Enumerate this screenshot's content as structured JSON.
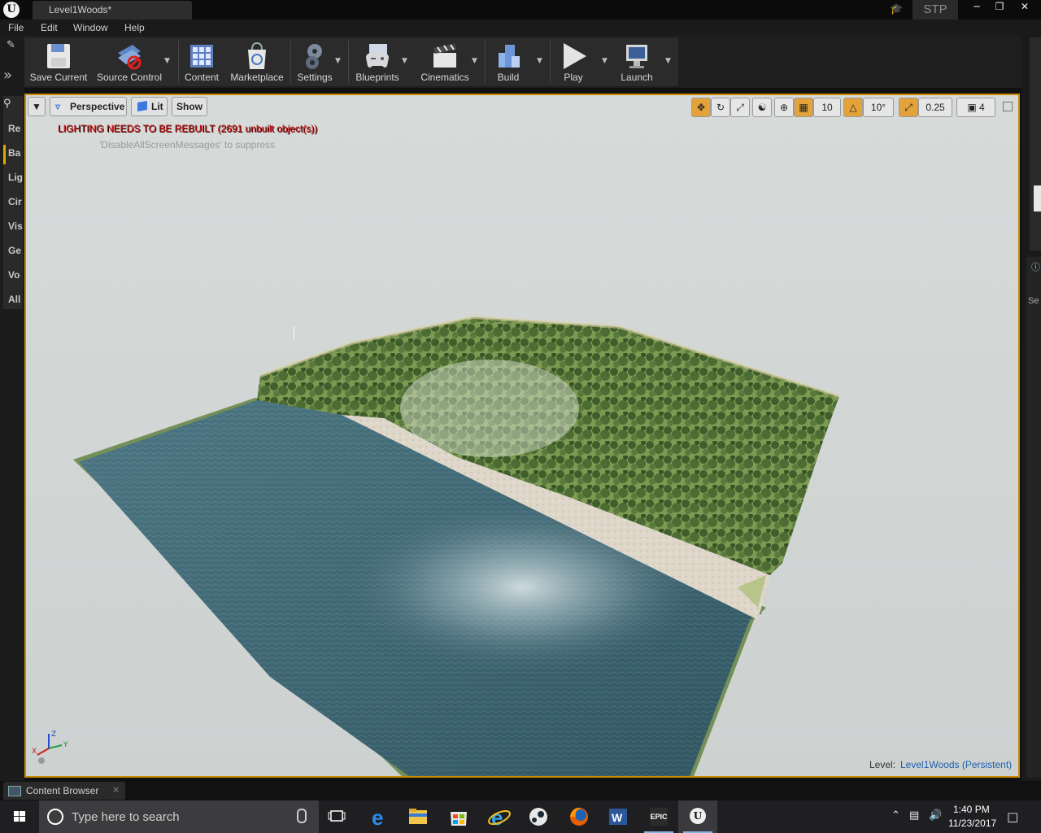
{
  "window": {
    "logo": "U",
    "document_tab": "Level1Woods*",
    "project_name": "STP"
  },
  "menu": [
    "File",
    "Edit",
    "Window",
    "Help"
  ],
  "modes_panel": {
    "categories": [
      "Re",
      "Ba",
      "Lig",
      "Cir",
      "Vis",
      "Ge",
      "Vo",
      "All"
    ]
  },
  "toolbar": {
    "save_label": "Save Current",
    "source_control_label": "Source Control",
    "content_label": "Content",
    "marketplace_label": "Marketplace",
    "settings_label": "Settings",
    "blueprints_label": "Blueprints",
    "cinematics_label": "Cinematics",
    "build_label": "Build",
    "play_label": "Play",
    "launch_label": "Launch"
  },
  "viewport": {
    "perspective_label": "Perspective",
    "lit_label": "Lit",
    "show_label": "Show",
    "warning": "LIGHTING NEEDS TO BE REBUILT (2691 unbuilt object(s))",
    "suppress_hint": "'DisableAllScreenMessages' to suppress",
    "grid_snap": "10",
    "rotation_snap": "10°",
    "scale_snap": "0.25",
    "camera_speed": "4",
    "level_label": "Level:",
    "level_value": "Level1Woods (Persistent)",
    "axes": {
      "x": "X",
      "y": "Y",
      "z": "Z"
    }
  },
  "right_dock": {
    "label": "Se"
  },
  "content_browser": {
    "tab_label": "Content Browser",
    "close": "×"
  },
  "taskbar": {
    "search_placeholder": "Type here to search",
    "epic_label": "EPIC",
    "time": "1:40 PM",
    "date": "11/23/2017"
  },
  "colors": {
    "accent": "#c88a00",
    "warning_text": "#c50e0e",
    "sky": "#d6dad9",
    "water": "#3f6975",
    "forest": "#5c7a3e",
    "sand": "#d8d2c6"
  }
}
